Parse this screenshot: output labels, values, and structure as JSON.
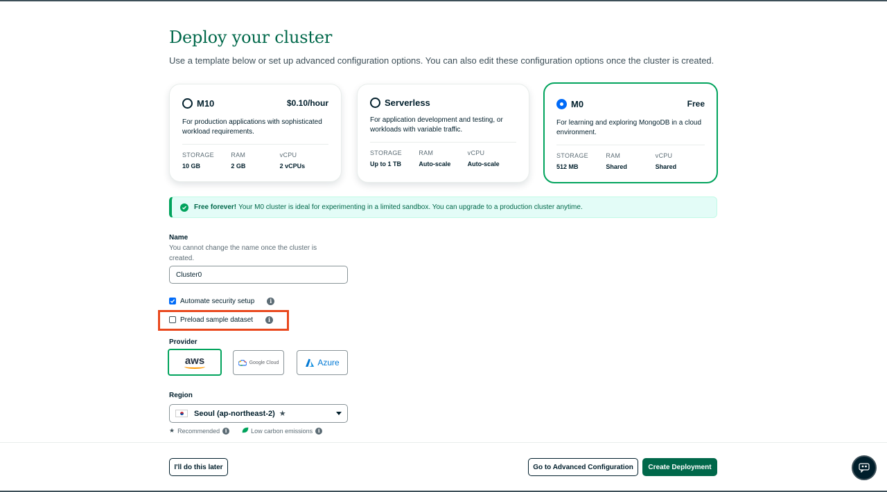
{
  "page": {
    "title": "Deploy your cluster",
    "subtitle": "Use a template below or set up advanced configuration options. You can also edit these configuration options once the cluster is created."
  },
  "tiers": [
    {
      "name": "M10",
      "price": "$0.10/hour",
      "description": "For production applications with sophisticated workload requirements.",
      "specs": [
        {
          "label": "STORAGE",
          "value": "10 GB"
        },
        {
          "label": "RAM",
          "value": "2 GB"
        },
        {
          "label": "vCPU",
          "value": "2 vCPUs"
        }
      ]
    },
    {
      "name": "Serverless",
      "price": "",
      "description": "For application development and testing, or workloads with variable traffic.",
      "specs": [
        {
          "label": "STORAGE",
          "value": "Up to 1 TB"
        },
        {
          "label": "RAM",
          "value": "Auto-scale"
        },
        {
          "label": "vCPU",
          "value": "Auto-scale"
        }
      ]
    },
    {
      "name": "M0",
      "price": "Free",
      "description": "For learning and exploring MongoDB in a cloud environment.",
      "specs": [
        {
          "label": "STORAGE",
          "value": "512 MB"
        },
        {
          "label": "RAM",
          "value": "Shared"
        },
        {
          "label": "vCPU",
          "value": "Shared"
        }
      ]
    }
  ],
  "banner": {
    "bold": "Free forever!",
    "text": "Your M0 cluster is ideal for experimenting in a limited sandbox. You can upgrade to a production cluster anytime."
  },
  "name_field": {
    "label": "Name",
    "help": "You cannot change the name once the cluster is created.",
    "value": "Cluster0"
  },
  "options": {
    "automate_security": "Automate security setup",
    "preload_sample": "Preload sample dataset"
  },
  "provider": {
    "label": "Provider",
    "aws": "aws",
    "google": "Google Cloud",
    "azure": "Azure"
  },
  "region": {
    "label": "Region",
    "selected": "Seoul (ap-northeast-2)",
    "recommended": "Recommended",
    "low_carbon": "Low carbon emissions"
  },
  "footer": {
    "later": "I'll do this later",
    "advanced": "Go to Advanced Configuration",
    "create": "Create Deployment"
  },
  "colors": {
    "brand_green": "#00684a",
    "accent_green": "#00a35c",
    "highlight": "#e9471c",
    "radio_blue": "#016bf8"
  }
}
